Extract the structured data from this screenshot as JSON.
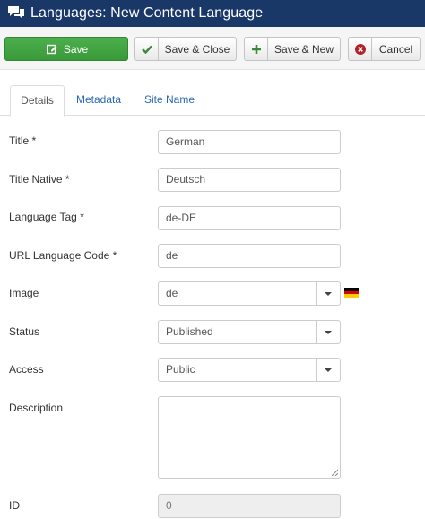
{
  "header": {
    "title": "Languages: New Content Language",
    "icon": "comments-icon"
  },
  "toolbar": {
    "save_label": "Save",
    "save_close_label": "Save & Close",
    "save_new_label": "Save & New",
    "cancel_label": "Cancel"
  },
  "tabs": [
    "Details",
    "Metadata",
    "Site Name"
  ],
  "form": {
    "title": {
      "label": "Title *",
      "value": "German"
    },
    "title_native": {
      "label": "Title Native *",
      "value": "Deutsch"
    },
    "language_tag": {
      "label": "Language Tag *",
      "value": "de-DE"
    },
    "url_code": {
      "label": "URL Language Code *",
      "value": "de"
    },
    "image": {
      "label": "Image",
      "value": "de"
    },
    "status": {
      "label": "Status",
      "value": "Published"
    },
    "access": {
      "label": "Access",
      "value": "Public"
    },
    "description": {
      "label": "Description",
      "value": ""
    },
    "id": {
      "label": "ID",
      "value": "0"
    }
  },
  "colors": {
    "header_bg": "#1a3867",
    "save_green": "#46a546",
    "tab_link": "#2a69b8",
    "cancel_red": "#b0232a"
  }
}
